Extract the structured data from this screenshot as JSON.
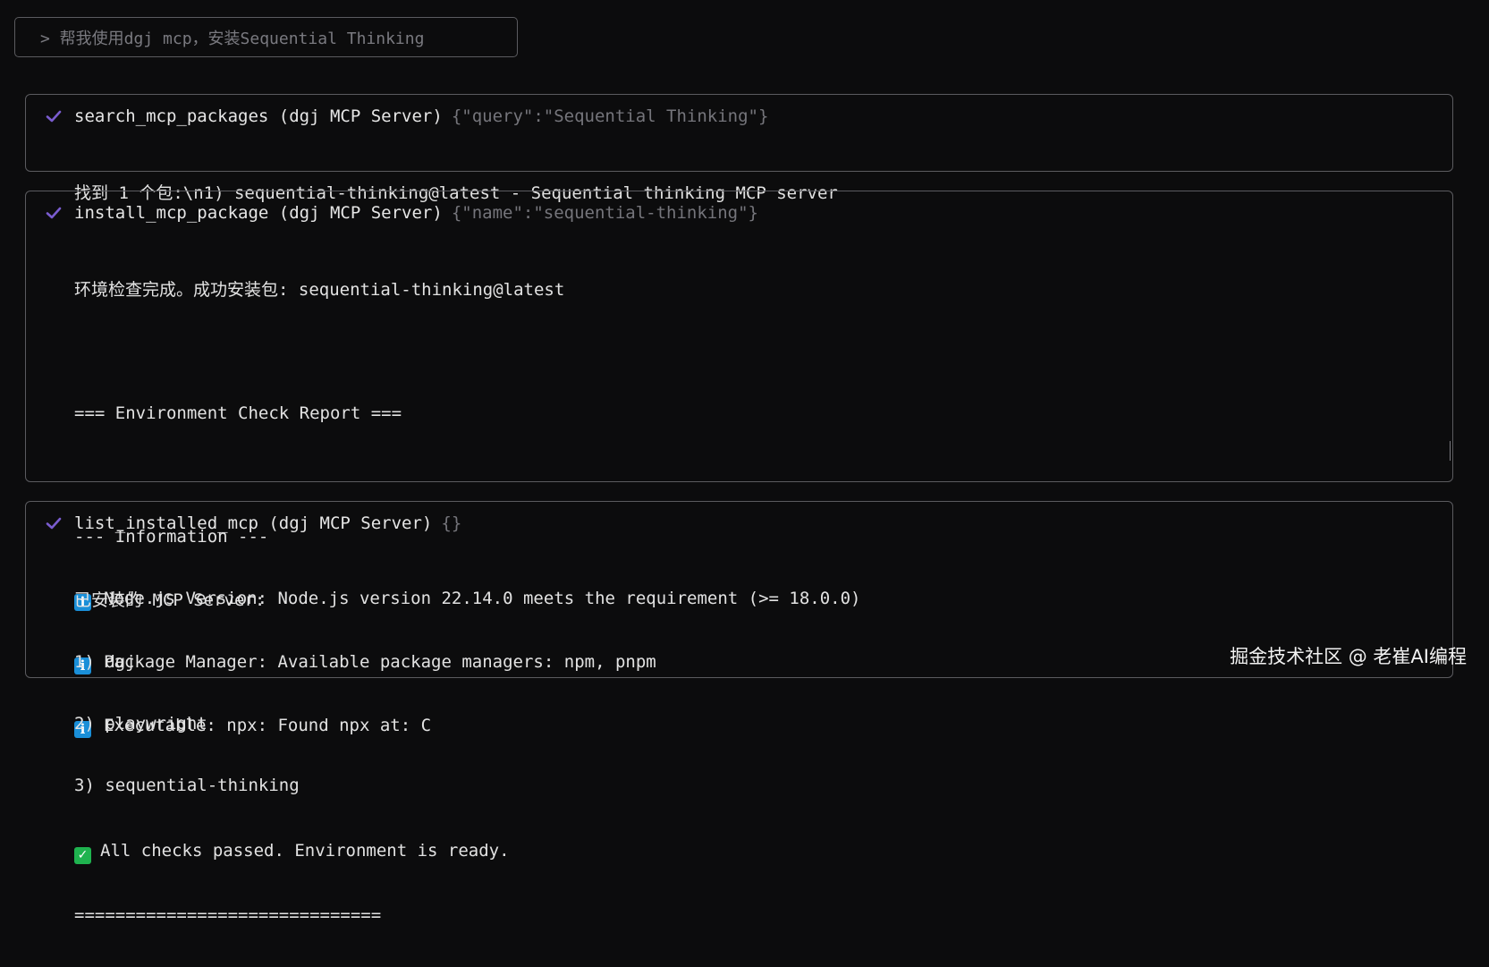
{
  "prompt": {
    "text": "> 帮我使用dgj mcp，安装Sequential Thinking"
  },
  "colors": {
    "check": "#7a5ccf",
    "info_badge": "#1a8fd8",
    "pass_badge": "#1fb34f",
    "border": "#5b5b5f",
    "muted_text": "#75757b"
  },
  "cards": [
    {
      "tool": "search_mcp_packages (dgj MCP Server)",
      "args": "{\"query\":\"Sequential Thinking\"}",
      "status_icon": "check-icon",
      "lines": {
        "l0": "找到 1 个包:\\n1) sequential-thinking@latest - Sequential thinking MCP server"
      }
    },
    {
      "tool": "install_mcp_package (dgj MCP Server)",
      "args": "{\"name\":\"sequential-thinking\"}",
      "status_icon": "check-icon",
      "lines": {
        "l0": "环境检查完成。成功安装包: sequential-thinking@latest",
        "l1": "=== Environment Check Report ===",
        "l2": "--- Information ---",
        "l3": "Node.js Version: Node.js version 22.14.0 meets the requirement (>= 18.0.0)",
        "l4": "Package Manager: Available package managers: npm, pnpm",
        "l5": "Executable: npx: Found npx at: C",
        "l6": "All checks passed. Environment is ready.",
        "l7": "=============================="
      },
      "info_icon_glyph": "i",
      "pass_icon_glyph": "✓"
    },
    {
      "tool": "list_installed_mcp (dgj MCP Server)",
      "args": "{}",
      "status_icon": "check-icon",
      "lines": {
        "l0": "已安装的 MCP Server:",
        "l1": "1) dgj",
        "l2": "2) playwright",
        "l3": "3) sequential-thinking"
      }
    }
  ],
  "watermark": {
    "text": "掘金技术社区 @ 老崔AI编程"
  }
}
